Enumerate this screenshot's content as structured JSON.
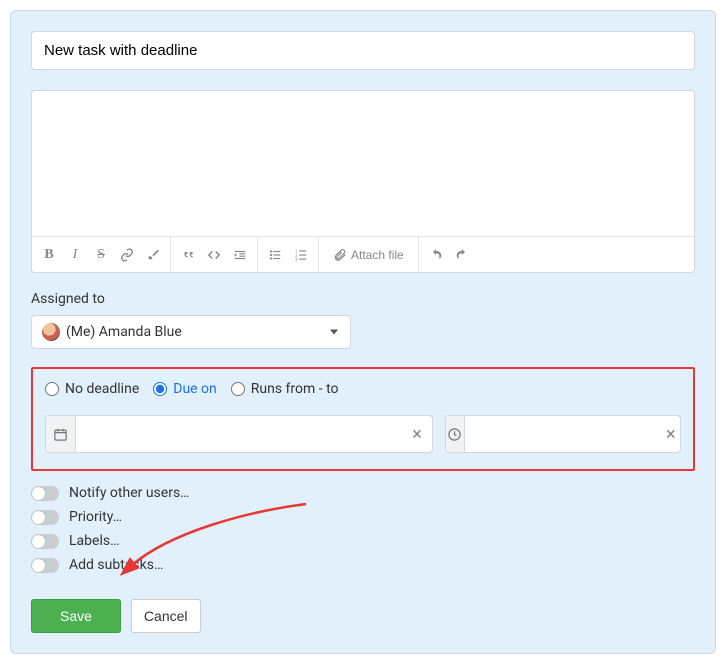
{
  "task": {
    "title_value": "New task with deadline"
  },
  "assigned": {
    "label": "Assigned to",
    "value": "(Me) Amanda Blue"
  },
  "toolbar": {
    "attach_label": "Attach file"
  },
  "deadline": {
    "options": {
      "none": "No deadline",
      "due": "Due on",
      "range": "Runs from - to"
    },
    "selected": "due"
  },
  "toggles": {
    "notify": "Notify other users…",
    "priority": "Priority…",
    "labels": "Labels…",
    "subtasks": "Add subtasks…"
  },
  "actions": {
    "save": "Save",
    "cancel": "Cancel"
  }
}
